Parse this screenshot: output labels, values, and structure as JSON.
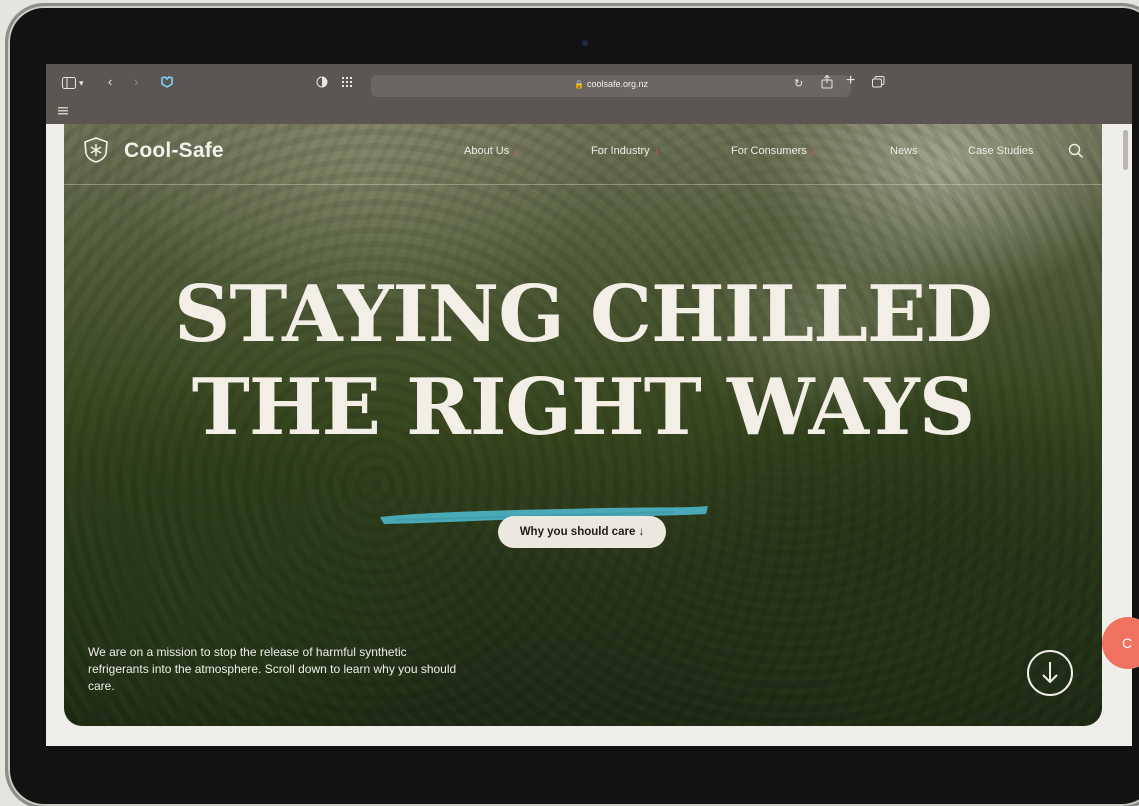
{
  "browser": {
    "url": "coolsafe.org.nz",
    "lock_icon": "lock-icon"
  },
  "site": {
    "logo_text": "Cool-Safe",
    "nav": [
      {
        "label": "About Us",
        "has_arrow": true
      },
      {
        "label": "For Industry",
        "has_arrow": true
      },
      {
        "label": "For Consumers",
        "has_arrow": true
      },
      {
        "label": "News",
        "has_arrow": false
      },
      {
        "label": "Case Studies",
        "has_arrow": false
      }
    ],
    "nav_arrow": "↓"
  },
  "hero": {
    "headline_line1": "STAYING CHILLED",
    "headline_line2": "THE RIGHT WAYS",
    "cta_label": "Why you should care ↓",
    "mission_text": "We are on a mission to stop the release of harmful synthetic refrigerants into the atmosphere. Scroll down to learn why you should care.",
    "accent_color": "#4aa9b6",
    "arrow_color": "#e5533c"
  },
  "chat": {
    "label": "C"
  }
}
